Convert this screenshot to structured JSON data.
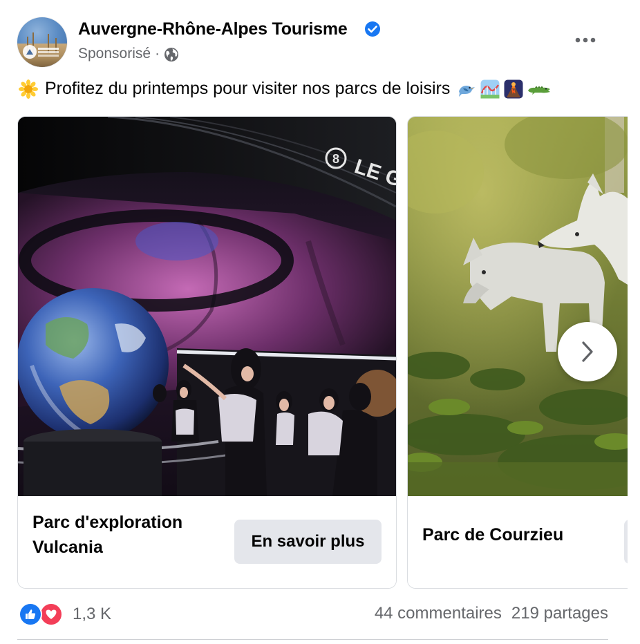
{
  "post": {
    "page_name": "Auvergne-Rhône-Alpes Tourisme",
    "sponsored_label": "Sponsorisé",
    "meta_separator": "·",
    "verified_icon": "verified-badge-icon",
    "privacy_icon": "globe-icon",
    "more_icon": "more-options-icon",
    "caption_text": "Profitez du printemps pour visiter nos parcs de loisirs",
    "caption_emojis": {
      "lead": "sunflower-emoji",
      "tail": [
        "bird-emoji",
        "roller-coaster-emoji",
        "volcano-emoji",
        "crocodile-emoji"
      ]
    }
  },
  "carousel": {
    "cards": [
      {
        "title": "Parc d'exploration Vulcania",
        "cta_label": "En savoir plus",
        "image_label": "vulcania-earth-globe-photo"
      },
      {
        "title": "Parc de Courzieu",
        "image_label": "white-wolves-photo"
      }
    ],
    "next_icon": "chevron-right-icon"
  },
  "engagement": {
    "reaction_icons": [
      "like-reaction-icon",
      "love-reaction-icon"
    ],
    "reaction_count": "1,3 K",
    "comments": "44 commentaires",
    "shares": "219 partages"
  },
  "colors": {
    "brand_blue": "#1877f2",
    "love_red": "#f33e58",
    "secondary_text": "#65676b",
    "button_bg": "#e4e6eb"
  }
}
